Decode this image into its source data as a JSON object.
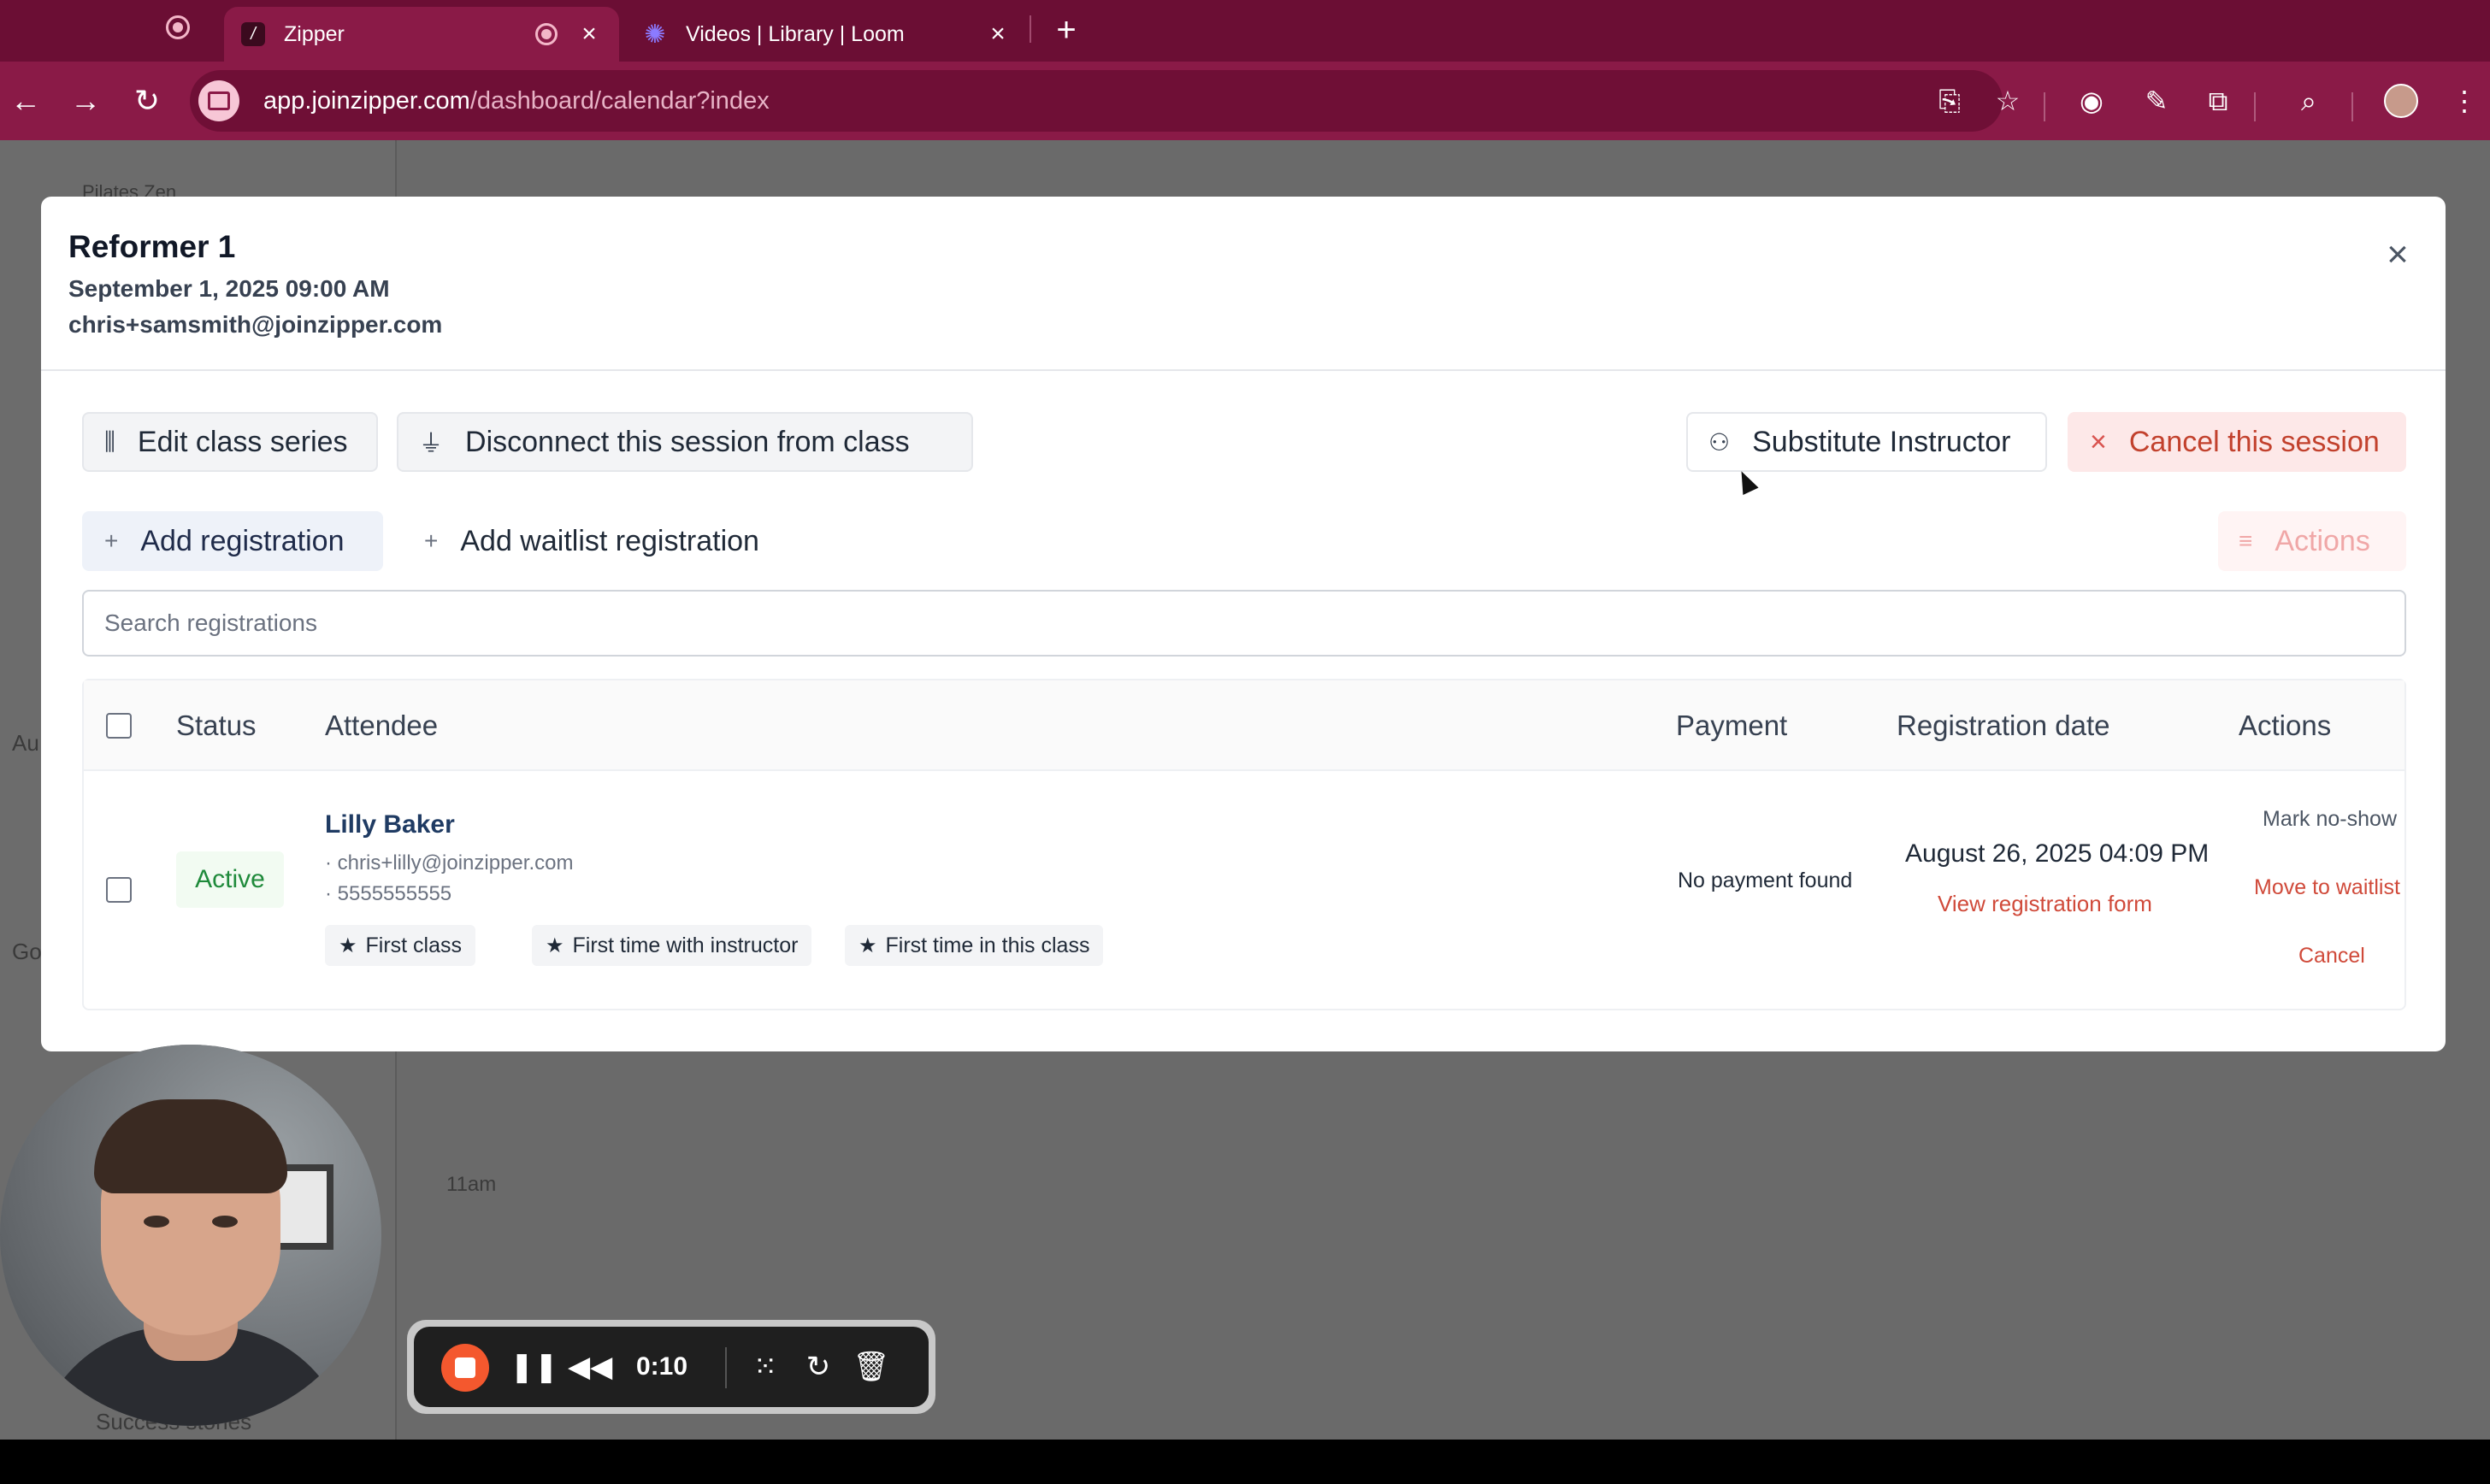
{
  "browser": {
    "tabs": [
      {
        "title": "Zipper",
        "active": true
      },
      {
        "title": "Videos | Library | Loom",
        "active": false
      }
    ],
    "url_host": "app.joinzipper.com",
    "url_path": "/dashboard/calendar?index"
  },
  "background": {
    "sidebar_items": [
      "Pilates Zen",
      "Au",
      "Go",
      "Success stories"
    ],
    "time_label": "11am"
  },
  "modal": {
    "title": "Reformer 1",
    "date": "September 1, 2025 09:00 AM",
    "email": "chris+samsmith@joinzipper.com",
    "buttons": {
      "edit_series": "Edit class series",
      "disconnect": "Disconnect this session from class",
      "substitute": "Substitute Instructor",
      "cancel_session": "Cancel this session",
      "add_registration": "Add registration",
      "add_waitlist": "Add waitlist registration",
      "actions": "Actions"
    },
    "search": {
      "placeholder": "Search registrations"
    },
    "table": {
      "columns": [
        "Status",
        "Attendee",
        "Payment",
        "Registration date",
        "Actions"
      ],
      "rows": [
        {
          "status": "Active",
          "name": "Lilly Baker",
          "email": "· chris+lilly@joinzipper.com",
          "phone": "· 5555555555",
          "tags": [
            "First class",
            "First time with instructor",
            "First time in this class"
          ],
          "payment": "No payment found",
          "registration_date": "August 26, 2025 04:09 PM",
          "view_form": "View registration form",
          "actions": [
            "Mark no-show",
            "Move to waitlist",
            "Cancel"
          ]
        }
      ]
    }
  },
  "loom": {
    "time": "0:10"
  },
  "colors": {
    "browser_bg": "#6b0e34",
    "toolbar": "#8a1a47",
    "danger": "#d04a3a",
    "success": "#1f8a3b"
  }
}
